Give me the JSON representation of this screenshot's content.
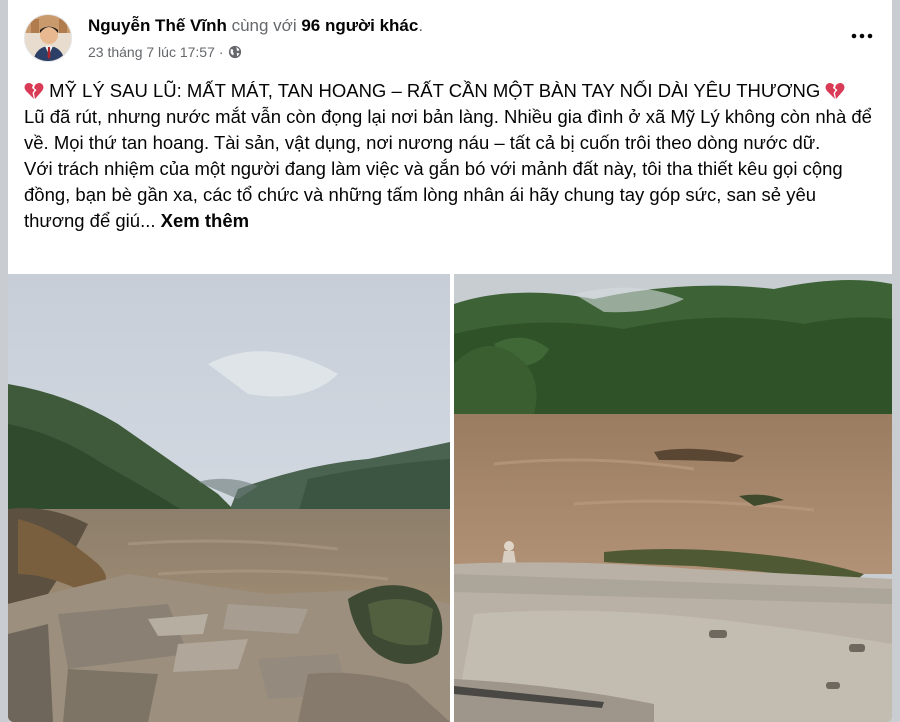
{
  "post": {
    "author": "Nguyễn Thế Vĩnh",
    "with_text": "cùng với",
    "others": "96 người khác",
    "others_suffix": ".",
    "timestamp": "23 tháng 7 lúc 17:57",
    "dot": "·",
    "more_menu": "···",
    "title": "MỸ LÝ SAU LŨ: MẤT MÁT, TAN HOANG – RẤT CẦN MỘT BÀN TAY NỐI DÀI YÊU THƯƠNG",
    "paragraph1": "Lũ đã rút, nhưng nước mắt vẫn còn đọng lại nơi bản làng. Nhiều gia đình ở xã Mỹ Lý không còn nhà để về. Mọi thứ tan hoang. Tài sản, vật dụng, nơi nương náu – tất cả bị cuốn trôi theo dòng nước dữ.",
    "paragraph2": "Với trách nhiệm của một người đang làm việc và gắn bó với mảnh đất này, tôi tha thiết kêu gọi cộng đồng, bạn bè gần xa, các tổ chức và những tấm lòng nhân ái hãy chung tay góp sức, san sẻ yêu thương để giú...",
    "see_more": "Xem thêm"
  },
  "icons": {
    "title_emoji": "broken-heart-icon",
    "privacy": "globe-icon",
    "menu": "more-horizontal-icon"
  },
  "colors": {
    "text": "#050505",
    "secondary_text": "#65676b",
    "broken_heart": "#d93b56"
  }
}
